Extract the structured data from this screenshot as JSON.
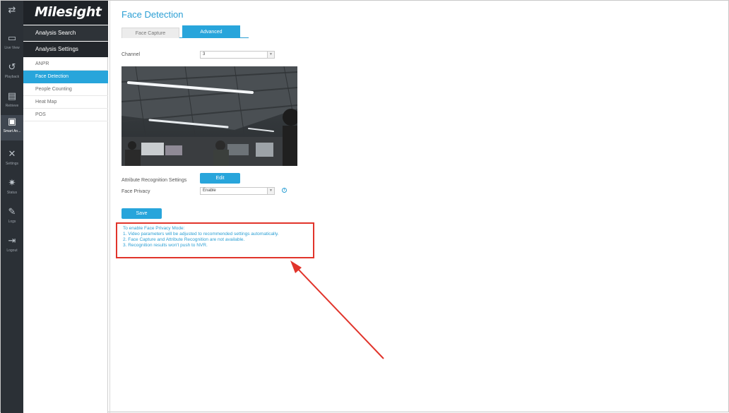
{
  "brand": {
    "logo": "Milesight"
  },
  "rail": [
    {
      "icon": "sliders-icon",
      "label": "",
      "glyph": "⇄"
    },
    {
      "icon": "live-view-icon",
      "label": "Live View",
      "glyph": "▭"
    },
    {
      "icon": "playback-icon",
      "label": "Playback",
      "glyph": "↺"
    },
    {
      "icon": "retrieve-icon",
      "label": "Retrieve",
      "glyph": "▤"
    },
    {
      "icon": "smart-analytics-icon",
      "label": "Smart An...",
      "glyph": "▣"
    },
    {
      "icon": "settings-icon",
      "label": "Settings",
      "glyph": "✕"
    },
    {
      "icon": "status-icon",
      "label": "Status",
      "glyph": "✷"
    },
    {
      "icon": "logs-icon",
      "label": "Logs",
      "glyph": "✎"
    },
    {
      "icon": "logout-icon",
      "label": "Logout",
      "glyph": "⇥"
    }
  ],
  "menu": {
    "group1": "Analysis Search",
    "group2": "Analysis Settings",
    "items": [
      "ANPR",
      "Face Detection",
      "People Counting",
      "Heat Map",
      "POS"
    ]
  },
  "main": {
    "title": "Face Detection",
    "tabs": [
      "Face Capture",
      "Advanced"
    ],
    "channel_label": "Channel",
    "channel_value": "3",
    "attr_label": "Attribute Recognition Settings",
    "edit_label": "Edit",
    "privacy_label": "Face Privacy",
    "privacy_value": "Enable",
    "save_label": "Save",
    "notice": [
      "To enable Face Privacy Mode:",
      "1. Video parameters will be adjusted to recommended settings automatically.",
      "2. Face Capture and Attribute Recognition are not available.",
      "3. Recognition results won't push to NVR."
    ]
  },
  "colors": {
    "accent": "#28a5db",
    "highlight": "#e1342b",
    "rail": "#2b3036"
  }
}
